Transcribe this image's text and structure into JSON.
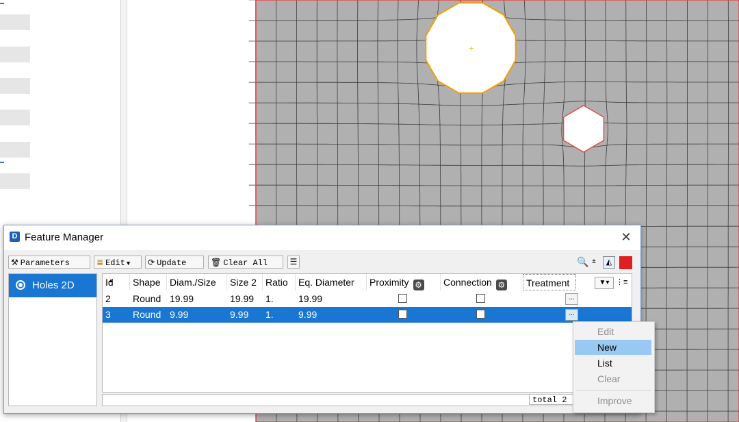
{
  "dialog": {
    "title": "Feature Manager",
    "close_glyph": "✕"
  },
  "toolbar": {
    "parameters_label": "Parameters",
    "edit_label": "Edit",
    "update_label": "Update",
    "clear_all_label": "Clear All"
  },
  "features": [
    {
      "label": "Holes 2D",
      "selected": true
    }
  ],
  "table": {
    "columns": [
      "Id",
      "Shape",
      "Diam./Size",
      "Size 2",
      "Ratio",
      "Eq. Diameter",
      "Proximity",
      "Connection",
      "Treatment"
    ],
    "rows": [
      {
        "id": "2",
        "shape": "Round",
        "diam": "19.99",
        "size2": "19.99",
        "ratio": "1.",
        "eq_diameter": "19.99",
        "proximity": false,
        "connection": false,
        "selected": false
      },
      {
        "id": "3",
        "shape": "Round",
        "diam": "9.99",
        "size2": "9.99",
        "ratio": "1.",
        "eq_diameter": "9.99",
        "proximity": false,
        "connection": false,
        "selected": true
      }
    ],
    "total_label": "total 2"
  },
  "context_menu": {
    "items": [
      {
        "label": "Edit",
        "enabled": false,
        "highlighted": false
      },
      {
        "label": "New",
        "enabled": true,
        "highlighted": true
      },
      {
        "label": "List",
        "enabled": true,
        "highlighted": false
      },
      {
        "label": "Clear",
        "enabled": false,
        "highlighted": false
      },
      {
        "label": "Improve",
        "enabled": false,
        "highlighted": false
      }
    ]
  },
  "colors": {
    "selection": "#1976d2",
    "menu_highlight": "#99c9f2",
    "mesh_fill": "#b0b0b0",
    "boundary": "#e8474a",
    "hole_selected_edge": "#f0a000"
  },
  "icons": {
    "app": "feature-manager-icon",
    "parameters": "tools-icon",
    "edit": "edit-list-icon",
    "update": "refresh-icon",
    "clear_all": "trash-icon",
    "gear": "gear-icon"
  }
}
